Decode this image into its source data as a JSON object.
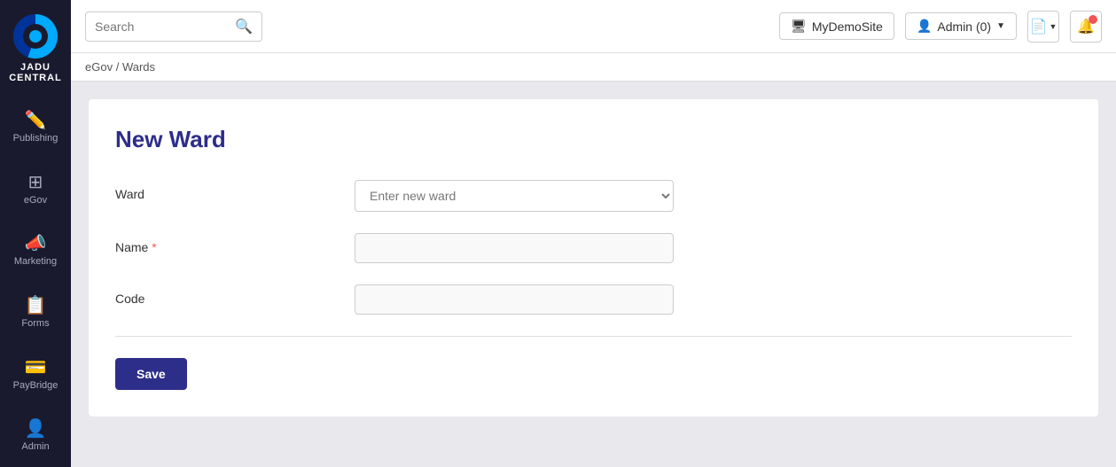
{
  "sidebar": {
    "logo": {
      "line1": "JADU",
      "line2": "CENTRAL"
    },
    "items": [
      {
        "id": "publishing",
        "label": "Publishing",
        "icon": "✏️",
        "active": false
      },
      {
        "id": "egov",
        "label": "eGov",
        "icon": "⊞",
        "active": false
      },
      {
        "id": "marketing",
        "label": "Marketing",
        "icon": "📣",
        "active": false
      },
      {
        "id": "forms",
        "label": "Forms",
        "icon": "📋",
        "active": false
      },
      {
        "id": "paybridge",
        "label": "PayBridge",
        "icon": "💳",
        "active": false
      },
      {
        "id": "admin",
        "label": "Admin",
        "icon": "👤",
        "active": false
      }
    ]
  },
  "header": {
    "search_placeholder": "Search",
    "site_button": "MyDemoSite",
    "admin_button": "Admin (0)",
    "site_icon": "🖥",
    "admin_icon": "👤"
  },
  "breadcrumb": {
    "parts": [
      "eGov",
      "Wards"
    ],
    "separator": " / "
  },
  "form": {
    "page_title": "New Ward",
    "ward_label": "Ward",
    "ward_placeholder": "Enter new ward",
    "name_label": "Name",
    "name_required": true,
    "code_label": "Code",
    "save_button": "Save"
  }
}
